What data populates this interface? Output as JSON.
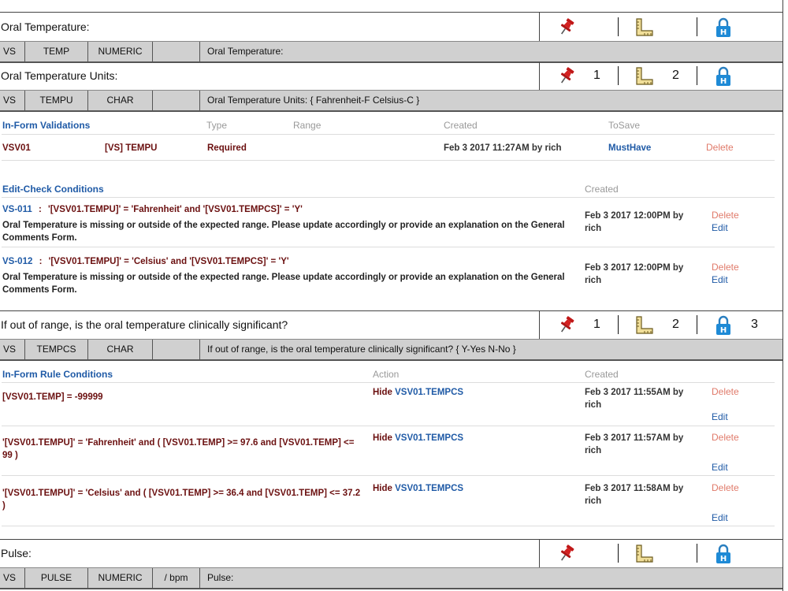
{
  "q1": {
    "title": "Oral Temperature:",
    "row": {
      "domain": "VS",
      "var": "TEMP",
      "type": "NUMERIC",
      "unit": "",
      "label": "Oral Temperature:"
    }
  },
  "q2": {
    "title": "Oral Temperature Units:",
    "count_pin": "1",
    "count_ruler": "2",
    "row": {
      "domain": "VS",
      "var": "TEMPU",
      "type": "CHAR",
      "unit": "",
      "label": "Oral Temperature Units: { Fahrenheit-F Celsius-C }"
    }
  },
  "validations": {
    "heading": "In-Form Validations",
    "col_type": "Type",
    "col_range": "Range",
    "col_created": "Created",
    "col_tosave": "ToSave",
    "rows": [
      {
        "id": "VSV01",
        "field": "[VS] TEMPU",
        "type": "Required",
        "created": "Feb 3 2017 11:27AM by rich",
        "tosave": "MustHave",
        "delete": "Delete"
      }
    ]
  },
  "editchecks": {
    "heading": "Edit-Check Conditions",
    "col_created": "Created",
    "rows": [
      {
        "id": "VS-011",
        "sep": ":",
        "cond": "'[VSV01.TEMPU]' = 'Fahrenheit' and '[VSV01.TEMPCS]' = 'Y'",
        "msg": "Oral Temperature is missing or outside of the expected range. Please update accordingly or provide an explanation on the General Comments Form.",
        "created": "Feb 3 2017 12:00PM by rich",
        "delete": "Delete",
        "edit": "Edit"
      },
      {
        "id": "VS-012",
        "sep": ":",
        "cond": "'[VSV01.TEMPU]' = 'Celsius' and '[VSV01.TEMPCS]' = 'Y'",
        "msg": "Oral Temperature is missing or outside of the expected range. Please update accordingly or provide an explanation on the General Comments Form.",
        "created": "Feb 3 2017 12:00PM by rich",
        "delete": "Delete",
        "edit": "Edit"
      }
    ]
  },
  "q3": {
    "title": "If out of range, is the oral temperature clinically significant?",
    "count_pin": "1",
    "count_ruler": "2",
    "count_lock": "3",
    "row": {
      "domain": "VS",
      "var": "TEMPCS",
      "type": "CHAR",
      "unit": "",
      "label": "If out of range, is the oral temperature clinically significant? { Y-Yes N-No }"
    }
  },
  "rules": {
    "heading": "In-Form Rule Conditions",
    "col_action": "Action",
    "col_created": "Created",
    "rows": [
      {
        "cond": "[VSV01.TEMP] = -99999",
        "action": "Hide",
        "target": "VSV01.TEMPCS",
        "created": "Feb 3 2017 11:55AM by rich",
        "delete": "Delete",
        "edit": "Edit"
      },
      {
        "cond": "'[VSV01.TEMPU]' = 'Fahrenheit' and ( [VSV01.TEMP] >= 97.6 and [VSV01.TEMP] <= 99 )",
        "action": "Hide",
        "target": "VSV01.TEMPCS",
        "created": "Feb 3 2017 11:57AM by rich",
        "delete": "Delete",
        "edit": "Edit"
      },
      {
        "cond": "'[VSV01.TEMPU]' = 'Celsius' and ( [VSV01.TEMP] >= 36.4 and [VSV01.TEMP] <= 37.2 )",
        "action": "Hide",
        "target": "VSV01.TEMPCS",
        "created": "Feb 3 2017 11:58AM by rich",
        "delete": "Delete",
        "edit": "Edit"
      }
    ]
  },
  "q4": {
    "title": "Pulse:",
    "row": {
      "domain": "VS",
      "var": "PULSE",
      "type": "NUMERIC",
      "unit": "/ bpm",
      "label": "Pulse:"
    }
  },
  "icons": {
    "pin": "pushpin-icon",
    "ruler": "ruler-icon",
    "lock": "lock-icon",
    "lock_letter": "H"
  }
}
